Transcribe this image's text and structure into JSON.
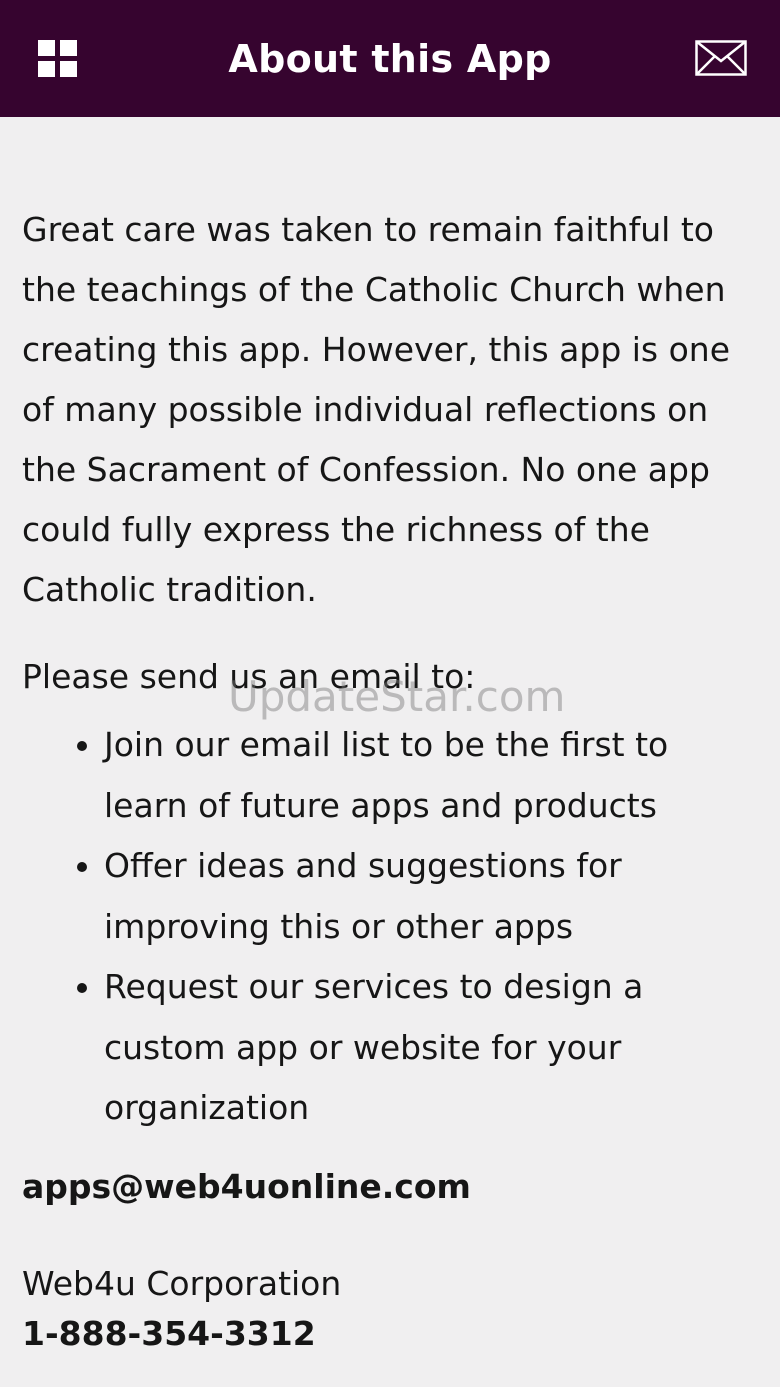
{
  "header": {
    "title": "About this App",
    "menu_icon": "grid-menu-icon",
    "mail_icon": "envelope-icon",
    "background_color": "#36042f"
  },
  "content": {
    "intro": "Great care was taken to remain faithful to the teachings of the Catholic Church when creating this app. However, this app is one of many possible individual reflections on the Sacrament of Confession. No one app could fully express the richness of the Catholic tradition.",
    "send_line": "Please send us an email to:",
    "bullets": [
      "Join our email list to be the first to learn of future apps and products",
      "Offer ideas and suggestions for improving this or other apps",
      "Request our services to design a custom app or website for your organization"
    ],
    "email": "apps@web4uonline.com",
    "company": "Web4u Corporation",
    "phone": "1-888-354-3312"
  },
  "watermark": "UpdateStar.com"
}
